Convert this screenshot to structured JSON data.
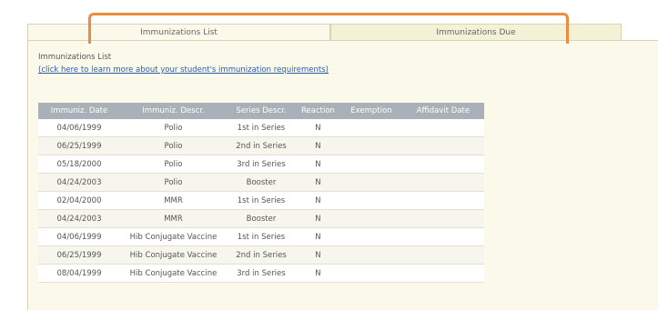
{
  "tabs": {
    "active": "Immunizations List",
    "inactive": "Immunizations Due"
  },
  "content": {
    "title": "Immunizations List",
    "learn_link": "(click here to learn more about your student's immunization requirements)"
  },
  "table": {
    "headers": [
      "Immuniz. Date",
      "Immuniz. Descr.",
      "Series Descr.",
      "Reaction",
      "Exemption",
      "Affidavit Date"
    ],
    "rows": [
      [
        "04/06/1999",
        "Polio",
        "1st in Series",
        "N",
        "",
        ""
      ],
      [
        "06/25/1999",
        "Polio",
        "2nd in Series",
        "N",
        "",
        ""
      ],
      [
        "05/18/2000",
        "Polio",
        "3rd in Series",
        "N",
        "",
        ""
      ],
      [
        "04/24/2003",
        "Polio",
        "Booster",
        "N",
        "",
        ""
      ],
      [
        "02/04/2000",
        "MMR",
        "1st in Series",
        "N",
        "",
        ""
      ],
      [
        "04/24/2003",
        "MMR",
        "Booster",
        "N",
        "",
        ""
      ],
      [
        "04/06/1999",
        "Hib Conjugate Vaccine",
        "1st in Series",
        "N",
        "",
        ""
      ],
      [
        "06/25/1999",
        "Hib Conjugate Vaccine",
        "2nd in Series",
        "N",
        "",
        ""
      ],
      [
        "08/04/1999",
        "Hib Conjugate Vaccine",
        "3rd in Series",
        "N",
        "",
        ""
      ]
    ]
  },
  "colors": {
    "highlight": "#f08a3e",
    "header_bg": "#a9b0b8",
    "panel_bg": "#fbfaea",
    "link": "#2a5db0"
  }
}
